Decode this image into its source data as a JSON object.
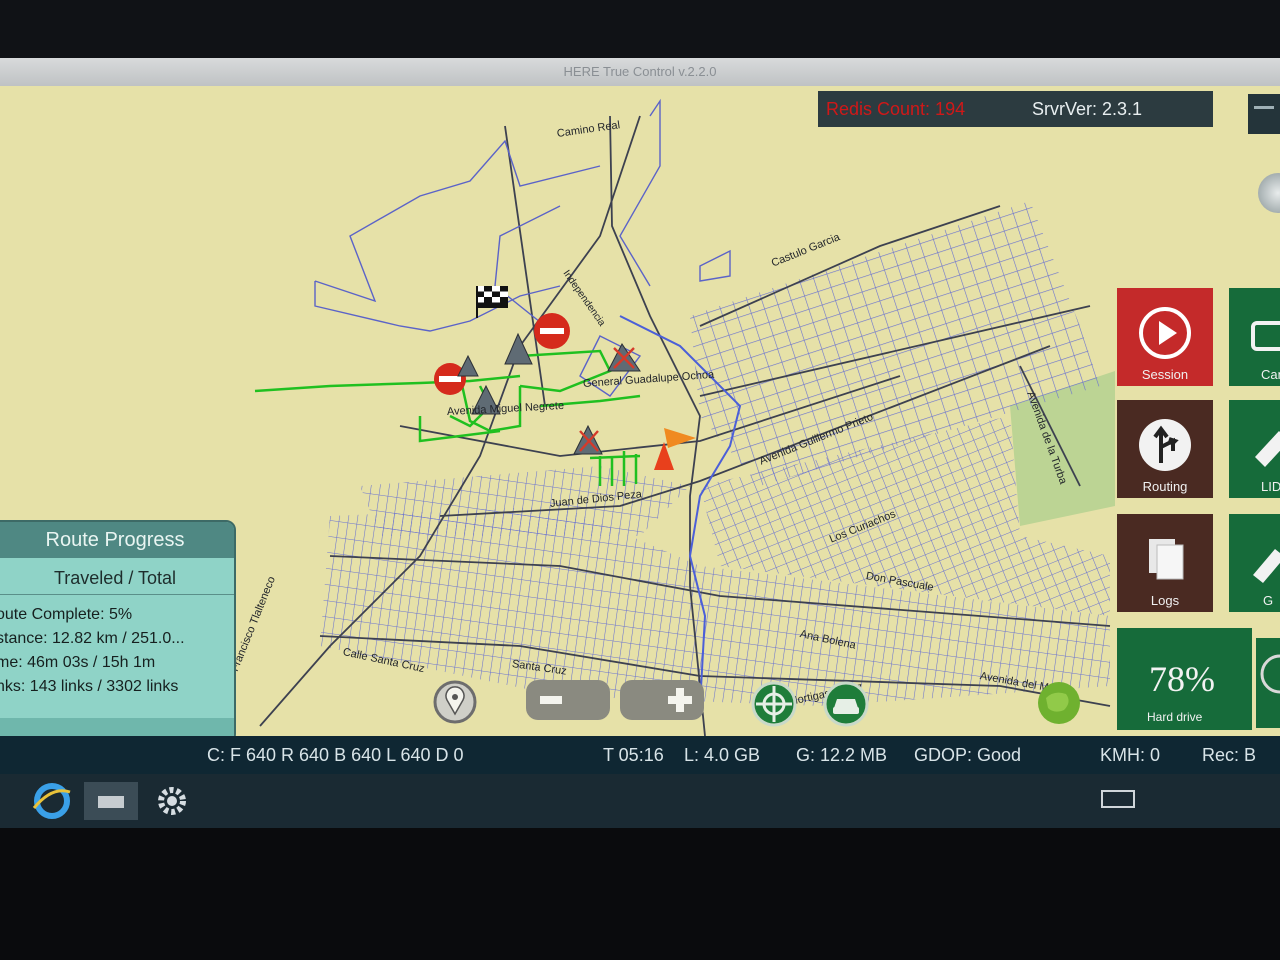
{
  "window": {
    "title": "HERE True Control v.2.2.0"
  },
  "server": {
    "redis_label": "Redis Count: 194",
    "srvr_ver": "SrvrVer: 2.3.1"
  },
  "map": {
    "streets": [
      "Camino Real",
      "Castulo Garcia",
      "Independencia",
      "General Guadalupe Ochoa",
      "Avenida Miguel Negrete",
      "Avenida Guillermo Prieto",
      "Avenida de la Turba",
      "Juan de Dios Peza",
      "Los Curiachos",
      "Don Pascuale",
      "San Francisco Tlalteneco",
      "Calle Santa Cruz",
      "Santa Cruz",
      "Ana Bolena",
      "Avenida del Mar",
      "Hortigas Lopez"
    ]
  },
  "side_menu": {
    "session": "Session",
    "routing": "Routing",
    "logs": "Logs",
    "camera_partial": "Cam",
    "lidar_partial": "LID",
    "g_partial": "G"
  },
  "drive": {
    "percent": "78%",
    "label": "Hard drive",
    "fill": 0.78
  },
  "route_progress": {
    "title": "Route Progress",
    "subtitle": "Traveled / Total",
    "complete": "oute Complete: 5%",
    "distance": "stance: 12.82 km / 251.0...",
    "time": "me: 46m 03s / 15h 1m",
    "links": "nks: 143 links / 3302 links"
  },
  "status": {
    "cameras": "C: F 640 R 640 B 640 L 640 D 0",
    "time": "T 05:16",
    "local": "L:   4.0 GB",
    "global": "G:  12.2 MB",
    "gdop": "GDOP: Good",
    "kmh": "KMH: 0",
    "rec": "Rec: B"
  },
  "colors": {
    "map_bg": "#e6e1a8",
    "road": "#5b63c8",
    "main_road": "#3a3f52",
    "route": "#20c020",
    "session_red": "#c42a2a",
    "menu_dark": "#4a2a22",
    "menu_green": "#166b3a",
    "status_bg": "#0f2733"
  },
  "icons": [
    "location-pin-icon",
    "zoom-out-icon",
    "zoom-in-icon",
    "recenter-icon",
    "car-icon",
    "globe-icon",
    "play-icon",
    "routing-arrow-icon",
    "logs-document-icon",
    "camera-icon",
    "gear-icon",
    "internet-explorer-icon",
    "keyboard-icon",
    "finish-flag-icon",
    "orange-flag-icon",
    "no-entry-icon"
  ]
}
